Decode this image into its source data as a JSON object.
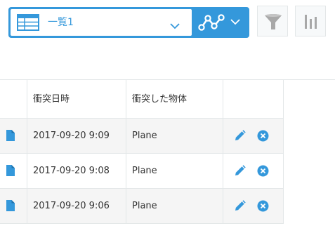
{
  "toolbar": {
    "view_name": "一覧1",
    "icons": {
      "view": "table-icon",
      "dropdown": "chevron-down-icon",
      "chart": "line-chart-icon",
      "filter": "filter-funnel-icon",
      "graph": "bar-graph-icon"
    }
  },
  "table": {
    "columns": [
      "衝突日時",
      "衝突した物体"
    ],
    "rows": [
      {
        "datetime": "2017-09-20 9:09",
        "object": "Plane"
      },
      {
        "datetime": "2017-09-20 9:08",
        "object": "Plane"
      },
      {
        "datetime": "2017-09-20 9:06",
        "object": "Plane"
      }
    ],
    "row_icons": {
      "open": "document-icon",
      "edit": "pencil-icon",
      "delete": "close-circle-icon"
    }
  },
  "colors": {
    "accent": "#3498db",
    "row_alt": "#f5f5f5",
    "border": "#e3e7e8",
    "icon_gray": "#a8a8a8"
  }
}
